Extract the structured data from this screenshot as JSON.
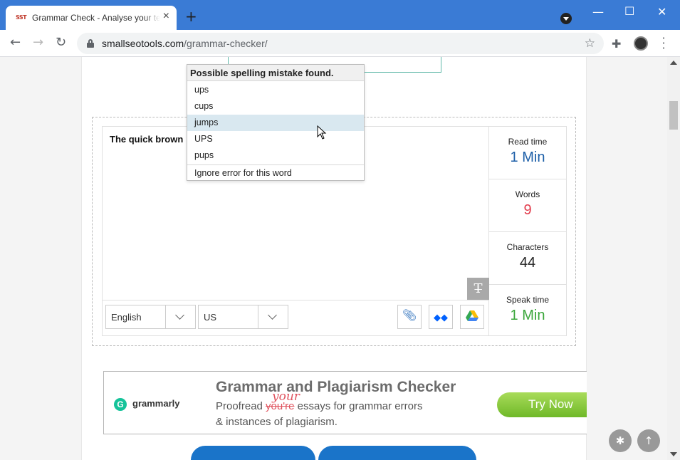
{
  "browser": {
    "tab_title": "Grammar Check - Analyse your text",
    "tab_favicon": "SST",
    "new_tab": "+",
    "url_host": "smallseotools.com",
    "url_path": "/grammar-checker/"
  },
  "suggestion_popup": {
    "header": "Possible spelling mistake found.",
    "suggestions": [
      "ups",
      "cups",
      "jumps",
      "UPS",
      "pups"
    ],
    "ignore_label": "Ignore error for this word"
  },
  "editor": {
    "text": "The quick brown"
  },
  "controls": {
    "language": "English",
    "variant": "US"
  },
  "stats": {
    "read_time_label": "Read time",
    "read_time_value": "1 Min",
    "words_label": "Words",
    "words_value": "9",
    "characters_label": "Characters",
    "characters_value": "44",
    "speak_time_label": "Speak time",
    "speak_time_value": "1 Min",
    "colors": {
      "read_time": "#1d5fa8",
      "words": "#e23b4b",
      "characters": "#222222",
      "speak_time": "#3aa63a"
    }
  },
  "ad": {
    "brand": "grammarly",
    "title": "Grammar and Plagiarism Checker",
    "line1_before": "Proofread ",
    "line1_strike": "you're",
    "line1_after": " essays for grammar errors",
    "correction": "your",
    "line2": "& instances of plagiarism.",
    "cta": "Try Now"
  },
  "icons": {
    "favicon": "sst-favicon-icon",
    "close": "close-icon",
    "back": "back-arrow-icon",
    "forward": "forward-arrow-icon",
    "reload": "reload-icon",
    "lock": "lock-icon",
    "star": "star-icon",
    "extensions": "puzzle-icon",
    "menu": "kebab-menu-icon",
    "attach": "paperclip-icon",
    "dropbox": "dropbox-icon",
    "drive": "google-drive-icon",
    "format": "clear-format-icon",
    "bug": "bug-icon",
    "scroll_top": "arrow-up-icon"
  }
}
